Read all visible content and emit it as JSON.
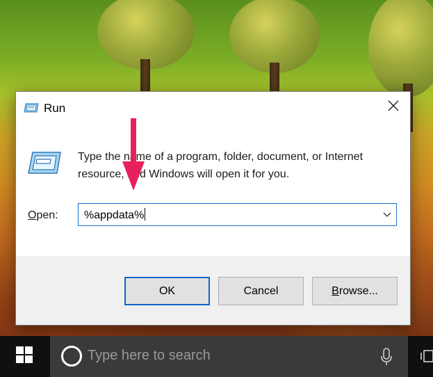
{
  "dialog": {
    "title": "Run",
    "description": "Type the name of a program, folder, document, or Internet resource, and Windows will open it for you.",
    "open_label_accel": "O",
    "open_label_rest": "pen:",
    "open_value": "%appdata%",
    "buttons": {
      "ok": "OK",
      "cancel": "Cancel",
      "browse_accel": "B",
      "browse_rest": "rowse..."
    }
  },
  "taskbar": {
    "search_placeholder": "Type here to search"
  },
  "colors": {
    "annotation_arrow": "#e8215c",
    "focus_border": "#1a73c8",
    "taskbar": "#101010",
    "search_box": "#3a3a3a"
  },
  "icons": {
    "title": "run-icon",
    "body": "run-icon",
    "close": "close-icon",
    "dropdown": "chevron-down-icon",
    "start": "windows-logo-icon",
    "cortana": "cortana-ring-icon",
    "microphone": "microphone-icon",
    "task_view": "task-view-icon"
  }
}
